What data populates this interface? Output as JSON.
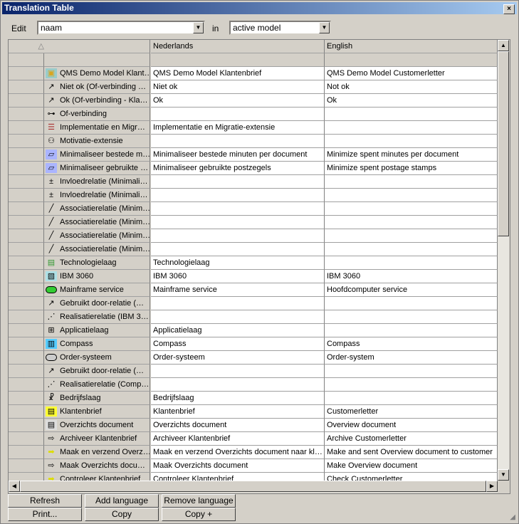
{
  "window": {
    "title": "Translation Table",
    "close": "×"
  },
  "toolbar": {
    "edit_label": "Edit",
    "field": "naam",
    "in_label": "in",
    "scope": "active model"
  },
  "columns": [
    "",
    "Nederlands",
    "English"
  ],
  "rows": [
    {
      "icon": "model-icon",
      "name": "QMS Demo Model Klant…",
      "nl": "QMS Demo Model Klantenbrief",
      "en": "QMS Demo Model Customerletter"
    },
    {
      "icon": "relation-arrow-icon",
      "name": "Niet ok (Of-verbinding …",
      "nl": "Niet ok",
      "en": "Not ok"
    },
    {
      "icon": "relation-arrow-icon",
      "name": "Ok (Of-verbinding - Kla…",
      "nl": "Ok",
      "en": "Ok"
    },
    {
      "icon": "junction-icon",
      "name": "Of-verbinding",
      "nl": "",
      "en": ""
    },
    {
      "icon": "viewpoint-icon",
      "name": "Implementatie en Migr…",
      "nl": "Implementatie en Migratie-extensie",
      "en": ""
    },
    {
      "icon": "motivation-icon",
      "name": "Motivatie-extensie",
      "nl": "",
      "en": ""
    },
    {
      "icon": "goal-icon",
      "name": "Minimaliseer bestede m…",
      "nl": "Minimaliseer bestede minuten per document",
      "en": "Minimize spent minutes per document"
    },
    {
      "icon": "goal-icon",
      "name": "Minimaliseer gebruikte …",
      "nl": "Minimaliseer gebruikte postzegels",
      "en": "Minimize spent postage stamps"
    },
    {
      "icon": "influence-icon",
      "name": "Invloedrelatie (Minimali…",
      "nl": "",
      "en": ""
    },
    {
      "icon": "influence-icon",
      "name": "Invloedrelatie (Minimali…",
      "nl": "",
      "en": ""
    },
    {
      "icon": "association-icon",
      "name": "Associatierelatie (Minim…",
      "nl": "",
      "en": ""
    },
    {
      "icon": "association-icon",
      "name": "Associatierelatie (Minim…",
      "nl": "",
      "en": ""
    },
    {
      "icon": "association-icon",
      "name": "Associatierelatie (Minim…",
      "nl": "",
      "en": ""
    },
    {
      "icon": "association-icon",
      "name": "Associatierelatie (Minim…",
      "nl": "",
      "en": ""
    },
    {
      "icon": "technology-layer-icon",
      "name": "Technologielaag",
      "nl": "Technologielaag",
      "en": ""
    },
    {
      "icon": "node-icon",
      "name": "IBM 3060",
      "nl": "IBM 3060",
      "en": "IBM 3060"
    },
    {
      "icon": "service-green-icon",
      "name": "Mainframe service",
      "nl": "Mainframe service",
      "en": "Hoofdcomputer service"
    },
    {
      "icon": "relation-arrow-icon",
      "name": "Gebruikt door-relatie (…",
      "nl": "",
      "en": ""
    },
    {
      "icon": "realization-icon",
      "name": "Realisatierelatie (IBM 3…",
      "nl": "",
      "en": ""
    },
    {
      "icon": "application-layer-icon",
      "name": "Applicatielaag",
      "nl": "Applicatielaag",
      "en": ""
    },
    {
      "icon": "component-icon",
      "name": "Compass",
      "nl": "Compass",
      "en": "Compass"
    },
    {
      "icon": "service-grey-icon",
      "name": "Order-systeem",
      "nl": "Order-systeem",
      "en": "Order-system"
    },
    {
      "icon": "relation-arrow-icon",
      "name": "Gebruikt door-relatie (…",
      "nl": "",
      "en": ""
    },
    {
      "icon": "realization-icon",
      "name": "Realisatierelatie (Comp…",
      "nl": "",
      "en": ""
    },
    {
      "icon": "business-layer-icon",
      "name": "Bedrijfslaag",
      "nl": "Bedrijfslaag",
      "en": ""
    },
    {
      "icon": "business-object-icon",
      "name": "Klantenbrief",
      "nl": "Klantenbrief",
      "en": "Customerletter"
    },
    {
      "icon": "document-icon",
      "name": "Overzichts document",
      "nl": "Overzichts document",
      "en": "Overview document"
    },
    {
      "icon": "process-white-icon",
      "name": "Archiveer Klantenbrief",
      "nl": "Archiveer Klantenbrief",
      "en": "Archive Customerletter"
    },
    {
      "icon": "process-yellow-icon",
      "name": "Maak en verzend Overz…",
      "nl": "Maak en verzend Overzichts document naar kl…",
      "en": "Make and sent Overview document to customer"
    },
    {
      "icon": "process-white-icon",
      "name": "Maak Overzichts docu…",
      "nl": "Maak Overzichts document",
      "en": "Make Overview document"
    },
    {
      "icon": "process-yellow-icon",
      "name": "Controleer Klantenbrief",
      "nl": "Controleer Klantenbrief",
      "en": "Check Customerletter"
    }
  ],
  "buttons": {
    "refresh": "Refresh",
    "add_language": "Add language",
    "remove_language": "Remove language",
    "print": "Print...",
    "copy": "Copy",
    "copy_plus": "Copy +"
  }
}
